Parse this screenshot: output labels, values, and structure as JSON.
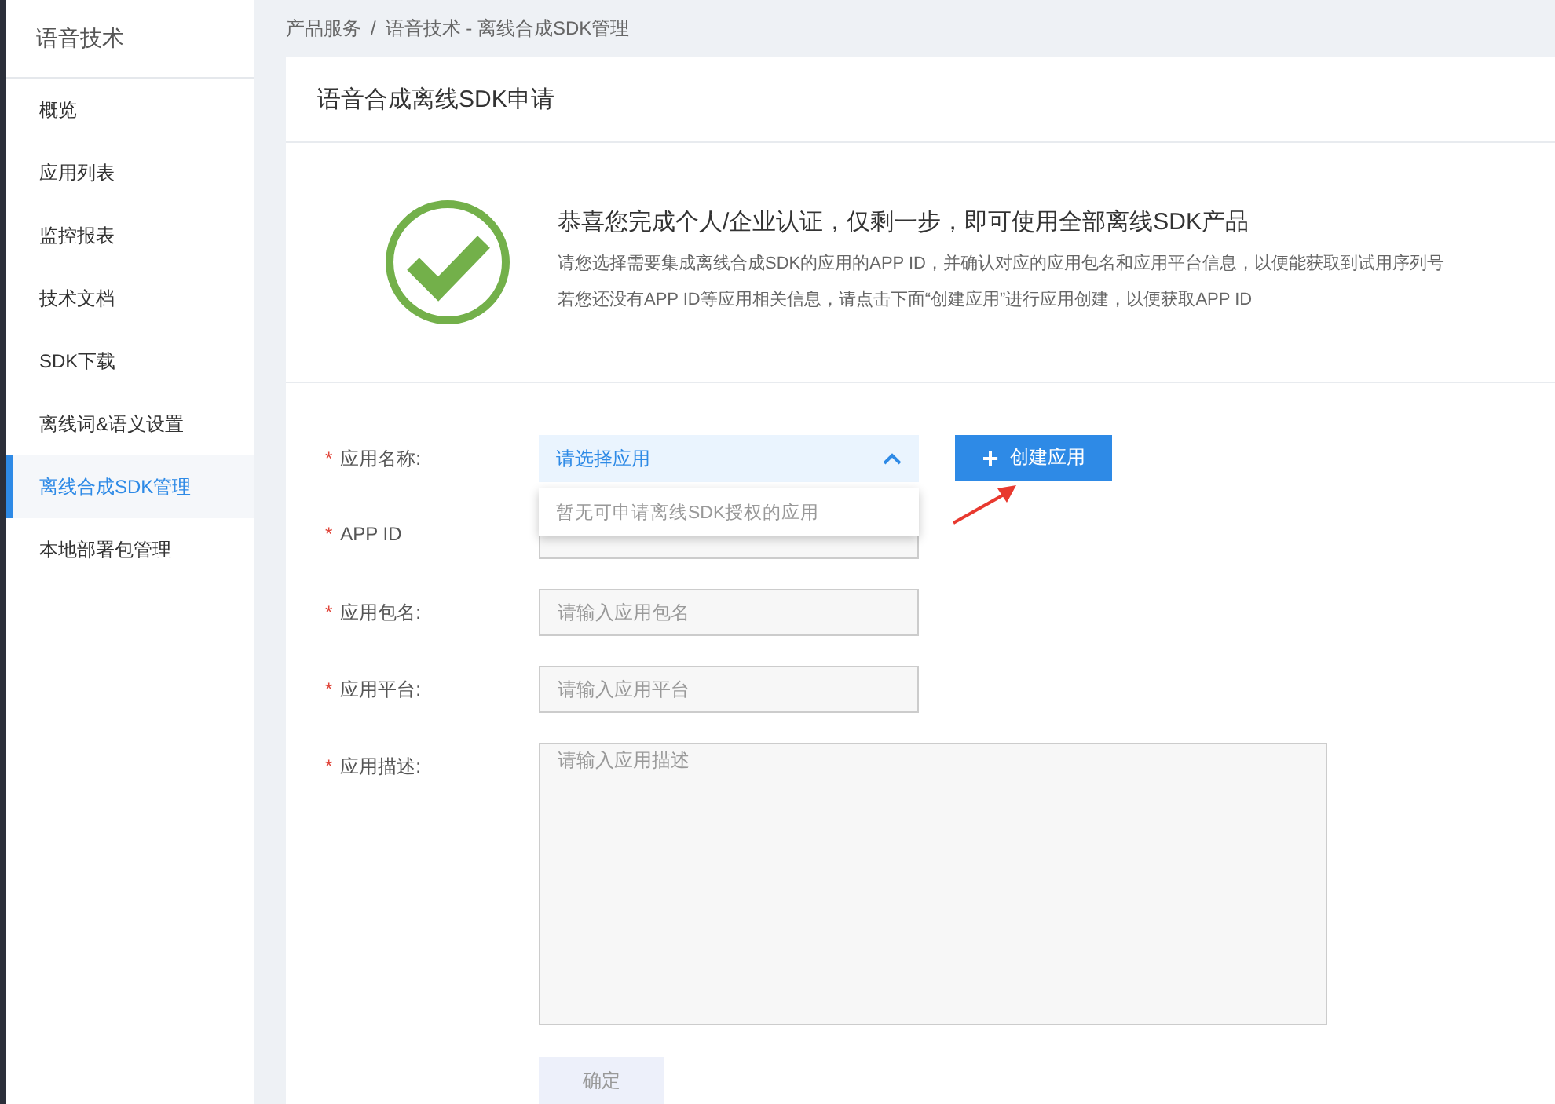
{
  "sidebar": {
    "title": "语音技术",
    "items": [
      {
        "label": "概览",
        "selected": false
      },
      {
        "label": "应用列表",
        "selected": false
      },
      {
        "label": "监控报表",
        "selected": false
      },
      {
        "label": "技术文档",
        "selected": false
      },
      {
        "label": "SDK下载",
        "selected": false
      },
      {
        "label": "离线词&语义设置",
        "selected": false
      },
      {
        "label": "离线合成SDK管理",
        "selected": true
      },
      {
        "label": "本地部署包管理",
        "selected": false
      }
    ]
  },
  "breadcrumb": {
    "items": [
      "产品服务",
      "语音技术 - 离线合成SDK管理"
    ],
    "separator": "/"
  },
  "page_title": "语音合成离线SDK申请",
  "notice": {
    "heading": "恭喜您完成个人/企业认证，仅剩一步，即可使用全部离线SDK产品",
    "lines": [
      "请您选择需要集成离线合成SDK的应用的APP ID，并确认对应的应用包名和应用平台信息，以便能获取到试用序列号",
      "若您还没有APP ID等应用相关信息，请点击下面“创建应用”进行应用创建，以便获取APP ID"
    ]
  },
  "form": {
    "required_mark": "*",
    "fields": [
      {
        "kind": "select",
        "label": "应用名称:",
        "placeholder": "请选择应用",
        "expanded": true,
        "dropdown_message": "暂无可申请离线SDK授权的应用",
        "action": {
          "icon": "+",
          "label": "创建应用"
        }
      },
      {
        "kind": "input",
        "label": "APP ID"
      },
      {
        "kind": "input",
        "label": "应用包名:",
        "placeholder": "请输入应用包名"
      },
      {
        "kind": "input",
        "label": "应用平台:",
        "placeholder": "请输入应用平台"
      },
      {
        "kind": "textarea",
        "label": "应用描述:",
        "placeholder": "请输入应用描述"
      }
    ],
    "submit": {
      "label": "确定",
      "disabled": true
    }
  }
}
